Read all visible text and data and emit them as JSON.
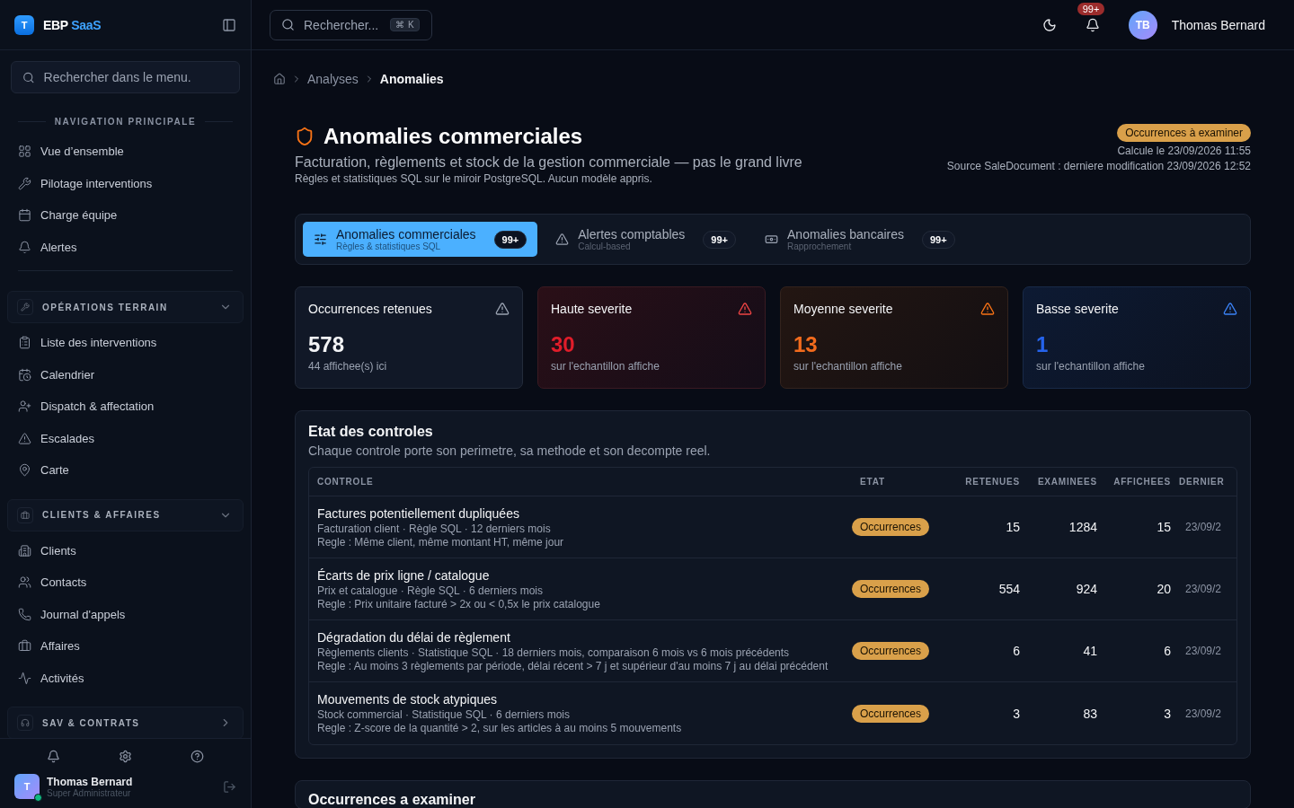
{
  "brand": {
    "initial": "T",
    "name": "EBP",
    "accent": "SaaS"
  },
  "sidebar": {
    "search": {
      "placeholder": "Rechercher dans le menu."
    },
    "sections": [
      {
        "kind": "plain",
        "title": "NAVIGATION PRINCIPALE",
        "items": [
          "Vue d’ensemble",
          "Pilotage interventions",
          "Charge équipe",
          "Alertes"
        ]
      },
      {
        "kind": "group",
        "title": "OPÉRATIONS TERRAIN",
        "expanded": true,
        "items": [
          "Liste des interventions",
          "Calendrier",
          "Dispatch & affectation",
          "Escalades",
          "Carte"
        ]
      },
      {
        "kind": "group",
        "title": "CLIENTS & AFFAIRES",
        "expanded": true,
        "items": [
          "Clients",
          "Contacts",
          "Journal d'appels",
          "Affaires",
          "Activités"
        ]
      },
      {
        "kind": "group",
        "title": "SAV & CONTRATS",
        "expanded": false
      }
    ],
    "user": {
      "initial": "T",
      "name": "Thomas Bernard",
      "role": "Super Administrateur",
      "online": true
    }
  },
  "topbar": {
    "search": {
      "placeholder": "Rechercher...",
      "keys": [
        "⌘",
        "K"
      ]
    },
    "notifications": "99+",
    "user": {
      "initials": "TB",
      "name": "Thomas Bernard"
    }
  },
  "breadcrumb": [
    {
      "label": "Analyses",
      "selected": false
    },
    {
      "label": "Anomalies",
      "selected": true
    }
  ],
  "header": {
    "title": "Anomalies commerciales",
    "subtitle": "Facturation, règlements et stock de la gestion commerciale — pas le grand livre",
    "note": "Règles et statistiques SQL sur le miroir PostgreSQL. Aucun modèle appris.",
    "badge": "Occurrences à examiner",
    "computed": "Calcule le 23/09/2026 11:55",
    "source": "Source SaleDocument : derniere modification 23/09/2026 12:52"
  },
  "tabs": [
    {
      "title": "Anomalies commerciales",
      "subtitle": "Règles & statistiques SQL",
      "count": "99+",
      "selected": true
    },
    {
      "title": "Alertes comptables",
      "subtitle": "Calcul-based",
      "count": "99+",
      "selected": false
    },
    {
      "title": "Anomalies bancaires",
      "subtitle": "Rapprochement",
      "count": "99+",
      "selected": false
    }
  ],
  "stats": [
    {
      "kind": "neutral",
      "title": "Occurrences retenues",
      "value": "578",
      "caption": "44 affichee(s) ici"
    },
    {
      "kind": "high",
      "title": "Haute severite",
      "value": "30",
      "caption": "sur l'echantillon affiche"
    },
    {
      "kind": "medium",
      "title": "Moyenne severite",
      "value": "13",
      "caption": "sur l'echantillon affiche"
    },
    {
      "kind": "low",
      "title": "Basse severite",
      "value": "1",
      "caption": "sur l'echantillon affiche"
    }
  ],
  "controls": {
    "title": "Etat des controles",
    "subtitle": "Chaque controle porte son perimetre, sa methode et son decompte reel.",
    "columns": [
      "CONTROLE",
      "ETAT",
      "RETENUES",
      "EXAMINEES",
      "AFFICHEES",
      "DERNIER"
    ],
    "rows": [
      {
        "name": "Factures potentiellement dupliquées",
        "scope": "Facturation client · Règle SQL · 12 derniers mois",
        "rule": "Regle : Même client, même montant HT, même jour",
        "status": "Occurrences",
        "retenues": "15",
        "examinees": "1284",
        "affichees": "15",
        "dernier": "23/09/2"
      },
      {
        "name": "Écarts de prix ligne / catalogue",
        "scope": "Prix et catalogue · Règle SQL · 6 derniers mois",
        "rule": "Regle : Prix unitaire facturé > 2x ou < 0,5x le prix catalogue",
        "status": "Occurrences",
        "retenues": "554",
        "examinees": "924",
        "affichees": "20",
        "dernier": "23/09/2"
      },
      {
        "name": "Dégradation du délai de règlement",
        "scope": "Règlements clients · Statistique SQL · 18 derniers mois, comparaison 6 mois vs 6 mois précédents",
        "rule": "Regle : Au moins 3 règlements par période, délai récent > 7 j et supérieur d'au moins 7 j au délai précédent",
        "status": "Occurrences",
        "retenues": "6",
        "examinees": "41",
        "affichees": "6",
        "dernier": "23/09/2"
      },
      {
        "name": "Mouvements de stock atypiques",
        "scope": "Stock commercial · Statistique SQL · 6 derniers mois",
        "rule": "Regle : Z-score de la quantité > 2, sur les articles à au moins 5 mouvements",
        "status": "Occurrences",
        "retenues": "3",
        "examinees": "83",
        "affichees": "3",
        "dernier": "23/09/2"
      }
    ]
  },
  "occurrences": {
    "title": "Occurrences a examiner"
  }
}
